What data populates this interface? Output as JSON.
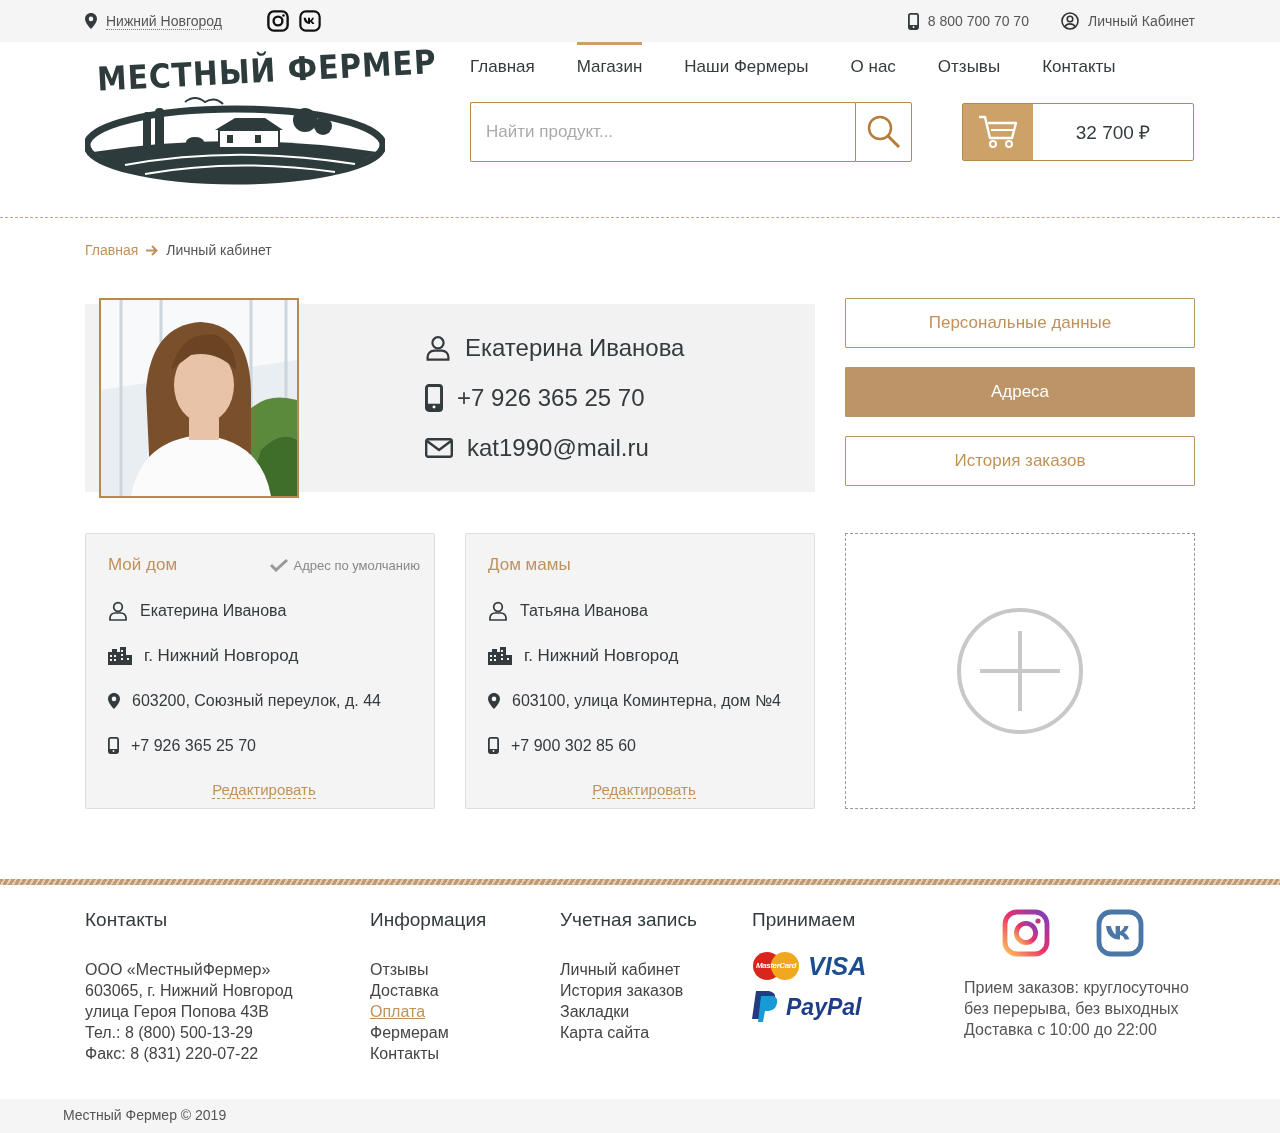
{
  "top_bar": {
    "city": "Нижний Новгород",
    "phone": "8 800 700 70 70",
    "account": "Личный Кабинет"
  },
  "logo": {
    "text": "МЕСТНЫЙ ФЕРМЕР"
  },
  "nav": [
    {
      "label": "Главная",
      "selected": false
    },
    {
      "label": "Магазин",
      "selected": true
    },
    {
      "label": "Наши Фермеры",
      "selected": false
    },
    {
      "label": "О нас",
      "selected": false
    },
    {
      "label": "Отзывы",
      "selected": false
    },
    {
      "label": "Контакты",
      "selected": false
    }
  ],
  "search": {
    "placeholder": "Найти продукт..."
  },
  "cart": {
    "total": "32 700 ₽"
  },
  "breadcrumbs": [
    "Главная",
    "Личный кабинет"
  ],
  "profile": {
    "name": "Екатерина Иванова",
    "phone": "+7 926 365 25 70",
    "email": "kat1990@mail.ru"
  },
  "profile_menu": [
    {
      "label": "Персональные данные",
      "selected": false
    },
    {
      "label": "Адреса",
      "selected": true
    },
    {
      "label": "История заказов",
      "selected": false
    }
  ],
  "addresses": [
    {
      "title": "Мой дом",
      "default": true,
      "default_label": "Адрес по умолчанию",
      "name": "Екатерина Иванова",
      "city": "г. Нижний Новгород",
      "street": "603200, Союзный переулок, д. 44",
      "phone": "+7 926 365 25 70",
      "edit": "Редактировать"
    },
    {
      "title": "Дом мамы",
      "default": false,
      "name": "Татьяна Иванова",
      "city": "г. Нижний Новгород",
      "street": "603100, улица Коминтерна, дом №4",
      "phone": "+7 900 302 85 60",
      "edit": "Редактировать"
    }
  ],
  "footer": {
    "contacts": {
      "title": "Контакты",
      "lines": [
        "ООО «МестныйФермер»",
        "603065, г. Нижний Новгород",
        "улица Героя Попова 43В",
        "Тел.: 8 (800) 500-13-29",
        "Факс: 8 (831) 220-07-22"
      ]
    },
    "link_columns": [
      {
        "title": "Информация",
        "links": [
          {
            "label": "Отзывы",
            "selected": false
          },
          {
            "label": "Доставка",
            "selected": false
          },
          {
            "label": "Оплата",
            "selected": true
          },
          {
            "label": "Фермерам",
            "selected": false
          },
          {
            "label": "Контакты",
            "selected": false
          }
        ]
      },
      {
        "title": "Учетная запись",
        "links": [
          {
            "label": "Личный кабинет",
            "selected": false
          },
          {
            "label": "История заказов",
            "selected": false
          },
          {
            "label": "Закладки",
            "selected": false
          },
          {
            "label": "Карта сайта",
            "selected": false
          }
        ]
      }
    ],
    "payments": {
      "title": "Принимаем",
      "mastercard": "MasterCard",
      "visa": "VISA",
      "paypal": "PayPal"
    },
    "hours": [
      "Прием заказов: круглосуточно",
      "без перерыва, без выходных",
      "Доставка с 10:00 до 22:00"
    ]
  },
  "copyright": "Местный Фермер © 2019"
}
